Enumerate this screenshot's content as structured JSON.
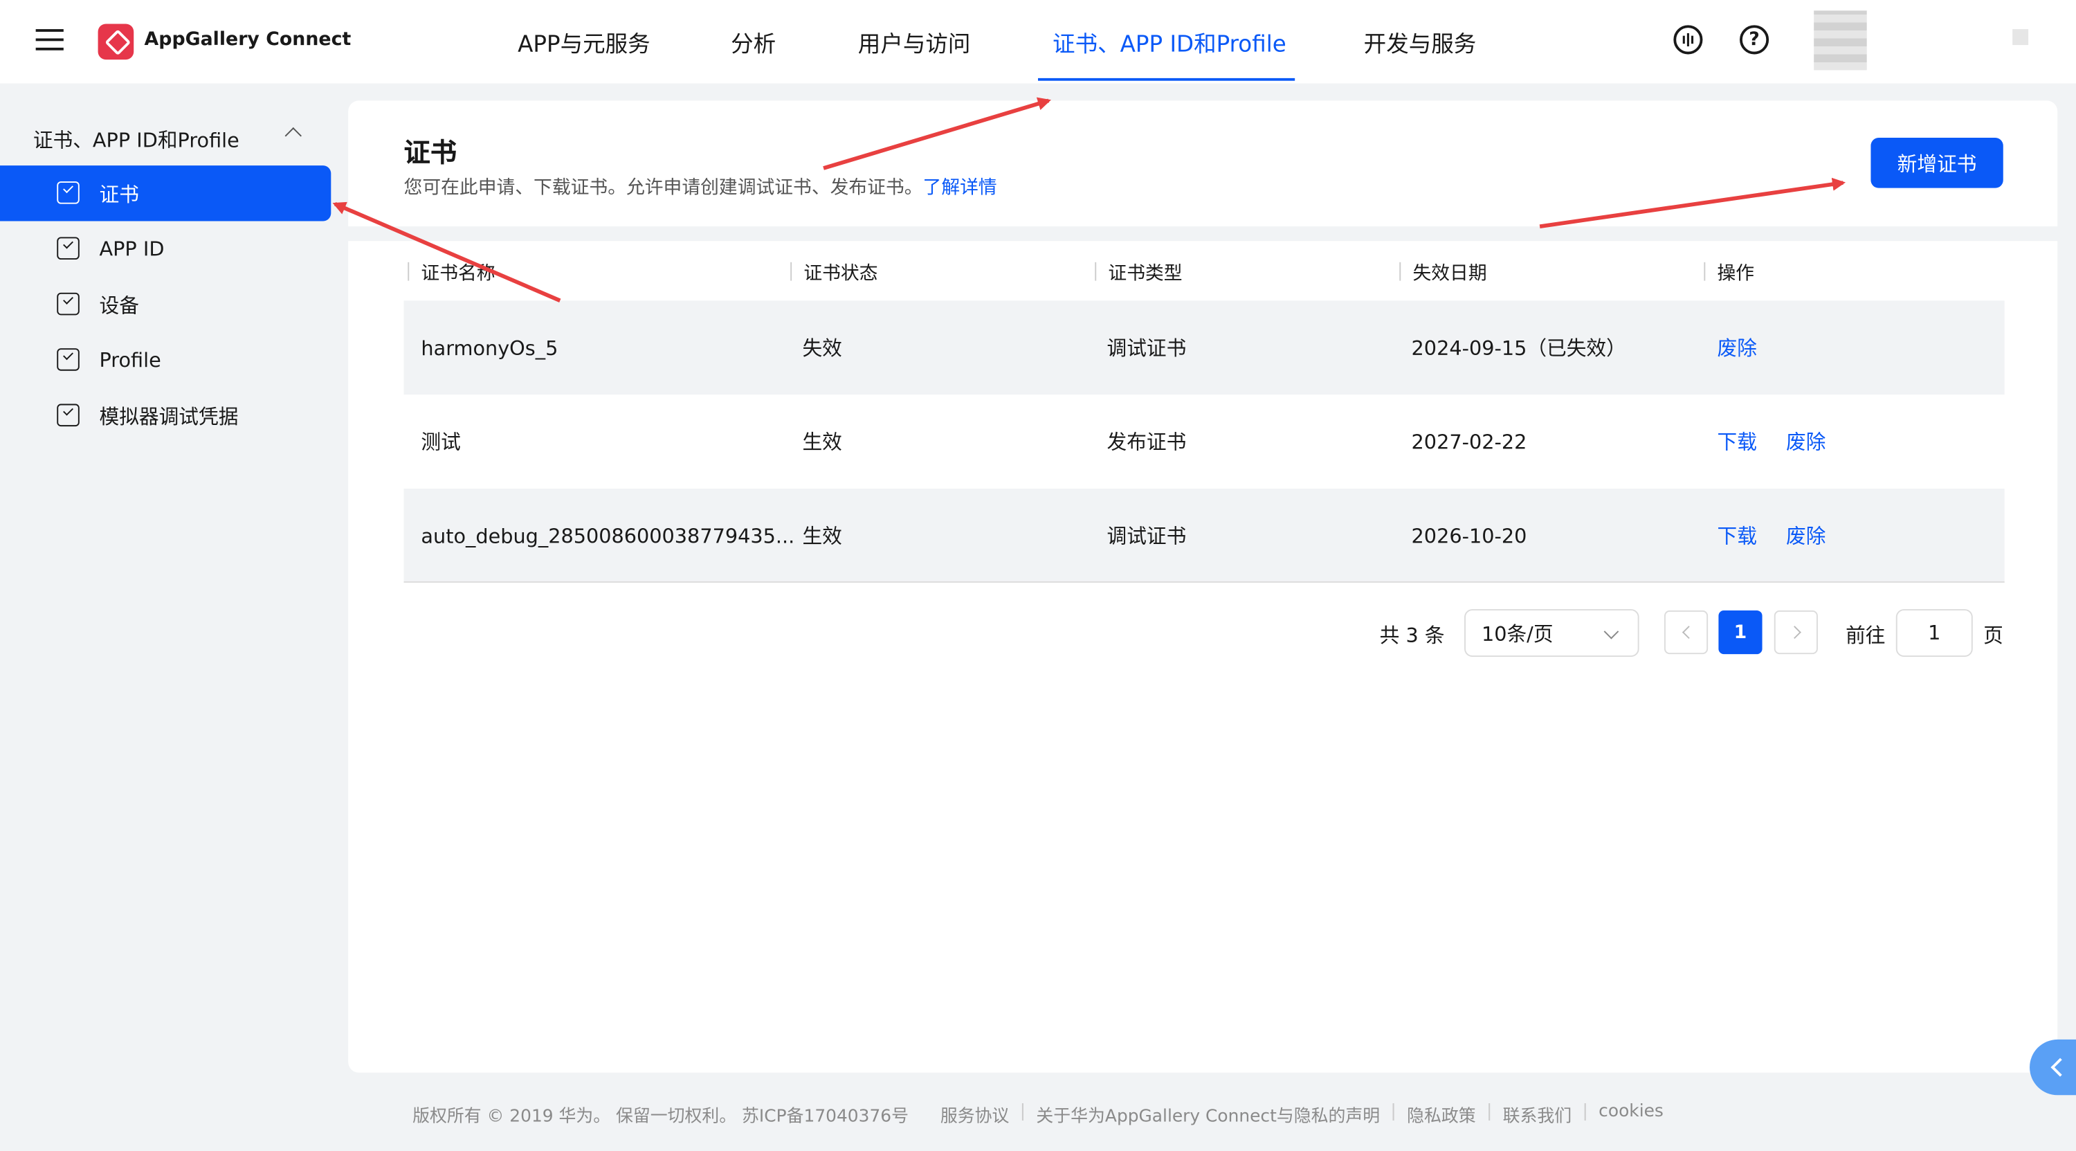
{
  "app": {
    "name": "AppGallery Connect",
    "brand_color": "#e6364a",
    "accent_color": "#0a59f7"
  },
  "topnav": {
    "items": [
      "APP与元服务",
      "分析",
      "用户与访问",
      "证书、APP ID和Profile",
      "开发与服务"
    ],
    "active_index": 3,
    "icons": [
      "hamburger-menu-icon",
      "message-icon",
      "help-icon"
    ]
  },
  "sidebar": {
    "group_label": "证书、APP ID和Profile",
    "items": [
      {
        "label": "证书",
        "active": true
      },
      {
        "label": "APP ID",
        "active": false
      },
      {
        "label": "设备",
        "active": false
      },
      {
        "label": "Profile",
        "active": false
      },
      {
        "label": "模拟器调试凭据",
        "active": false
      }
    ]
  },
  "page": {
    "title": "证书",
    "description": "您可在此申请、下载证书。允许申请创建调试证书、发布证书。",
    "learn_more": "了解详情",
    "add_button": "新增证书"
  },
  "table": {
    "headers": [
      "证书名称",
      "证书状态",
      "证书类型",
      "失效日期",
      "操作"
    ],
    "rows": [
      {
        "name": "harmonyOs_5",
        "status": "失效",
        "type": "调试证书",
        "expiry": "2024-09-15（已失效）",
        "actions": [
          "废除"
        ]
      },
      {
        "name": "测试",
        "status": "生效",
        "type": "发布证书",
        "expiry": "2027-02-22",
        "actions": [
          "下载",
          "废除"
        ]
      },
      {
        "name": "auto_debug_285008600038779435...",
        "status": "生效",
        "type": "调试证书",
        "expiry": "2026-10-20",
        "actions": [
          "下载",
          "废除"
        ]
      }
    ]
  },
  "pagination": {
    "total_text": "共 3 条",
    "page_size": "10条/页",
    "current_page": "1",
    "goto_label": "前往",
    "goto_value": "1",
    "page_suffix": "页"
  },
  "footer": {
    "copyright": "版权所有 © 2019 华为。 保留一切权利。 苏ICP备17040376号",
    "links": [
      "服务协议",
      "关于华为AppGallery Connect与隐私的声明",
      "隐私政策",
      "联系我们",
      "cookies"
    ]
  }
}
